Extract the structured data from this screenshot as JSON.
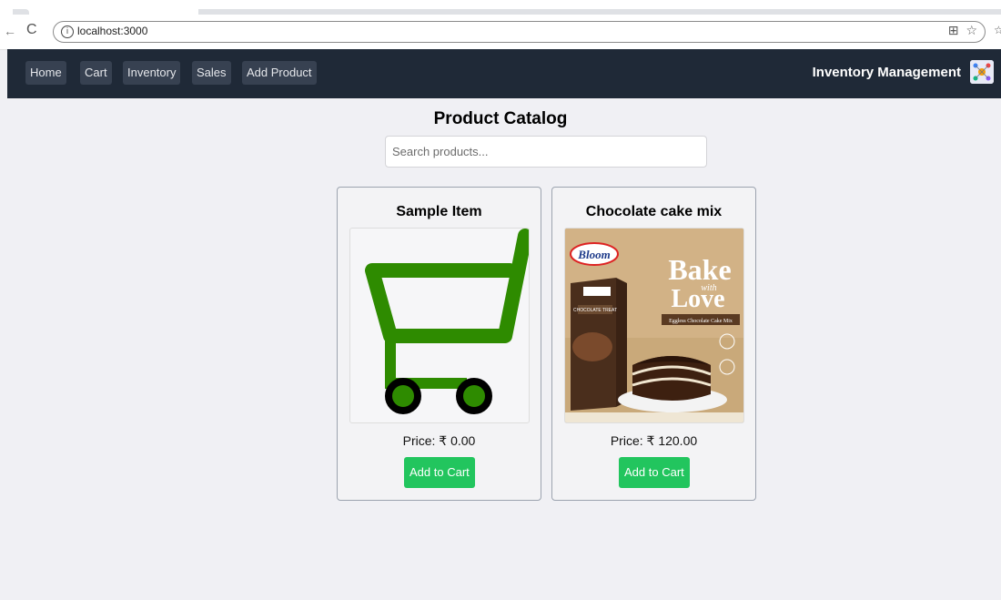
{
  "browser": {
    "url": "localhost:3000",
    "info_icon": "info-icon"
  },
  "nav": {
    "items": [
      "Home",
      "Cart",
      "Inventory",
      "Sales",
      "Add Product"
    ],
    "brand": "Inventory Management"
  },
  "catalog": {
    "title": "Product Catalog",
    "search_placeholder": "Search products...",
    "products": [
      {
        "name": "Sample Item",
        "price": "Price: ₹ 0.00",
        "button": "Add to Cart",
        "image": "cart-icon"
      },
      {
        "name": "Chocolate cake mix",
        "price": "Price: ₹ 120.00",
        "button": "Add to Cart",
        "image": "cake-mix-box"
      }
    ]
  },
  "product_image_text": {
    "brand": "Bloom",
    "headline_1": "Bake",
    "headline_2": "with",
    "headline_3": "Love",
    "sub": "Eggless Chocolate Cake Mix",
    "box_label": "CHOCOLATE TREAT"
  },
  "colors": {
    "navbar": "#1f2937",
    "button": "#22c55e",
    "cart_green": "#2e8b00"
  }
}
